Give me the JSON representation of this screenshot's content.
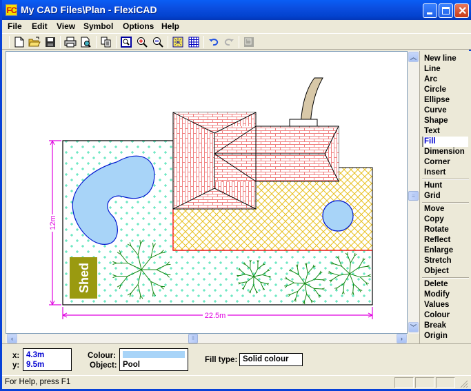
{
  "window": {
    "app_icon_text": "FC",
    "title": "My CAD Files\\Plan - FlexiCAD"
  },
  "menu": [
    "File",
    "Edit",
    "View",
    "Symbol",
    "Options",
    "Help"
  ],
  "toolbar": {
    "buttons": [
      "new-file",
      "open-folder",
      "save",
      "print",
      "print-preview",
      "copy",
      "zoom-window",
      "zoom-in",
      "zoom-out",
      "snap",
      "grid",
      "undo",
      "redo",
      "layers"
    ]
  },
  "drawing": {
    "dim_vertical": "12m",
    "dim_horizontal": "22.5m",
    "shed_label": "Shed",
    "colors": {
      "roof": "#f08080",
      "patio": "#e8c020",
      "pool": "#a8d4f8",
      "pool_stroke": "#0018d0",
      "lawn_dots": "#40e0b0",
      "tree": "#128a12",
      "shed": "#9a9a10",
      "dimension": "#e000e0",
      "path": "#d8c8a8",
      "patio_border": "#ff0000"
    }
  },
  "commands": {
    "group1": [
      "New line",
      "Line",
      "Arc",
      "Circle",
      "Ellipse",
      "Curve",
      "Shape",
      "Text",
      "Fill",
      "Dimension",
      "Corner",
      "Insert"
    ],
    "group2": [
      "Hunt",
      "Grid"
    ],
    "group3": [
      "Move",
      "Copy",
      "Rotate",
      "Reflect",
      "Enlarge",
      "Stretch",
      "Object"
    ],
    "group4": [
      "Delete",
      "Modify",
      "Values",
      "Colour",
      "Break",
      "Origin"
    ],
    "active": "Fill"
  },
  "info": {
    "x_label": "x:",
    "x_value": "4.3m",
    "y_label": "y:",
    "y_value": "9.5m",
    "colour_label": "Colour:",
    "colour_swatch": "#a8d4f8",
    "object_label": "Object:",
    "object_value": "Pool",
    "filltype_label": "Fill type:",
    "filltype_value": "Solid colour"
  },
  "status": {
    "help_text": "For Help, press F1"
  }
}
